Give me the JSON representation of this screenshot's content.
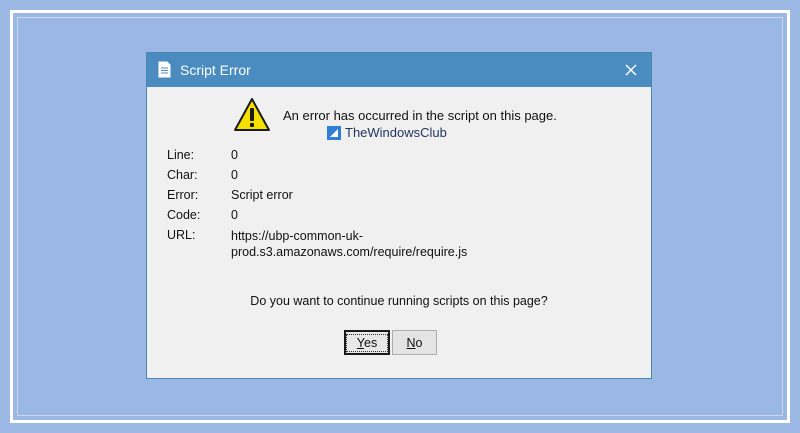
{
  "dialog": {
    "title": "Script Error",
    "message": "An error has occurred in the script on this page.",
    "watermark": "TheWindowsClub",
    "details": {
      "line_label": "Line:",
      "line_value": "0",
      "char_label": "Char:",
      "char_value": "0",
      "error_label": "Error:",
      "error_value": "Script error",
      "code_label": "Code:",
      "code_value": "0",
      "url_label": "URL:",
      "url_value": "https://ubp-common-uk-prod.s3.amazonaws.com/require/require.js"
    },
    "question": "Do you want to continue running scripts on this page?",
    "yes_button": {
      "underline": "Y",
      "rest": "es"
    },
    "no_button": {
      "underline": "N",
      "rest": "o"
    }
  },
  "colors": {
    "titlebar": "#4a8cc0",
    "background": "#9bb7e3",
    "dialog_body": "#f0f0f0"
  },
  "icons": {
    "title": "document-icon",
    "close": "close-icon",
    "warning": "warning-icon",
    "watermark_logo": "windows-club-logo"
  }
}
